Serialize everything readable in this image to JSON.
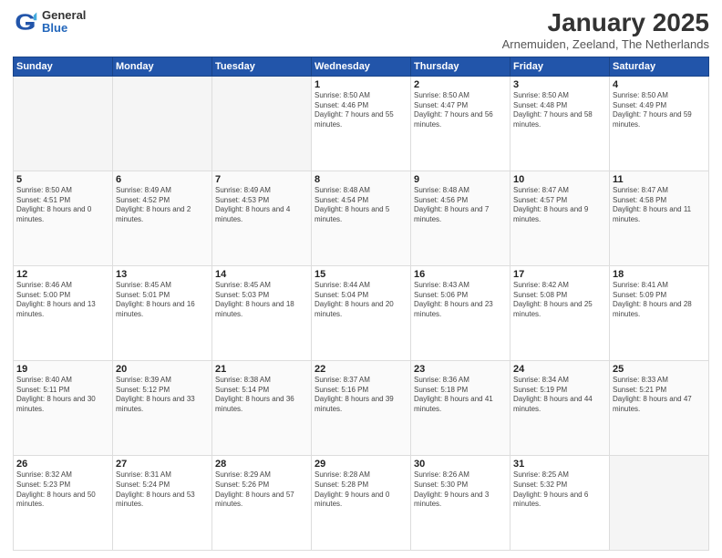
{
  "logo": {
    "general": "General",
    "blue": "Blue"
  },
  "title": "January 2025",
  "subtitle": "Arnemuiden, Zeeland, The Netherlands",
  "days_header": [
    "Sunday",
    "Monday",
    "Tuesday",
    "Wednesday",
    "Thursday",
    "Friday",
    "Saturday"
  ],
  "weeks": [
    [
      {
        "day": "",
        "empty": true
      },
      {
        "day": "",
        "empty": true
      },
      {
        "day": "",
        "empty": true
      },
      {
        "day": "1",
        "sunrise": "8:50 AM",
        "sunset": "4:46 PM",
        "daylight": "7 hours and 55 minutes."
      },
      {
        "day": "2",
        "sunrise": "8:50 AM",
        "sunset": "4:47 PM",
        "daylight": "7 hours and 56 minutes."
      },
      {
        "day": "3",
        "sunrise": "8:50 AM",
        "sunset": "4:48 PM",
        "daylight": "7 hours and 58 minutes."
      },
      {
        "day": "4",
        "sunrise": "8:50 AM",
        "sunset": "4:49 PM",
        "daylight": "7 hours and 59 minutes."
      }
    ],
    [
      {
        "day": "5",
        "sunrise": "8:50 AM",
        "sunset": "4:51 PM",
        "daylight": "8 hours and 0 minutes."
      },
      {
        "day": "6",
        "sunrise": "8:49 AM",
        "sunset": "4:52 PM",
        "daylight": "8 hours and 2 minutes."
      },
      {
        "day": "7",
        "sunrise": "8:49 AM",
        "sunset": "4:53 PM",
        "daylight": "8 hours and 4 minutes."
      },
      {
        "day": "8",
        "sunrise": "8:48 AM",
        "sunset": "4:54 PM",
        "daylight": "8 hours and 5 minutes."
      },
      {
        "day": "9",
        "sunrise": "8:48 AM",
        "sunset": "4:56 PM",
        "daylight": "8 hours and 7 minutes."
      },
      {
        "day": "10",
        "sunrise": "8:47 AM",
        "sunset": "4:57 PM",
        "daylight": "8 hours and 9 minutes."
      },
      {
        "day": "11",
        "sunrise": "8:47 AM",
        "sunset": "4:58 PM",
        "daylight": "8 hours and 11 minutes."
      }
    ],
    [
      {
        "day": "12",
        "sunrise": "8:46 AM",
        "sunset": "5:00 PM",
        "daylight": "8 hours and 13 minutes."
      },
      {
        "day": "13",
        "sunrise": "8:45 AM",
        "sunset": "5:01 PM",
        "daylight": "8 hours and 16 minutes."
      },
      {
        "day": "14",
        "sunrise": "8:45 AM",
        "sunset": "5:03 PM",
        "daylight": "8 hours and 18 minutes."
      },
      {
        "day": "15",
        "sunrise": "8:44 AM",
        "sunset": "5:04 PM",
        "daylight": "8 hours and 20 minutes."
      },
      {
        "day": "16",
        "sunrise": "8:43 AM",
        "sunset": "5:06 PM",
        "daylight": "8 hours and 23 minutes."
      },
      {
        "day": "17",
        "sunrise": "8:42 AM",
        "sunset": "5:08 PM",
        "daylight": "8 hours and 25 minutes."
      },
      {
        "day": "18",
        "sunrise": "8:41 AM",
        "sunset": "5:09 PM",
        "daylight": "8 hours and 28 minutes."
      }
    ],
    [
      {
        "day": "19",
        "sunrise": "8:40 AM",
        "sunset": "5:11 PM",
        "daylight": "8 hours and 30 minutes."
      },
      {
        "day": "20",
        "sunrise": "8:39 AM",
        "sunset": "5:12 PM",
        "daylight": "8 hours and 33 minutes."
      },
      {
        "day": "21",
        "sunrise": "8:38 AM",
        "sunset": "5:14 PM",
        "daylight": "8 hours and 36 minutes."
      },
      {
        "day": "22",
        "sunrise": "8:37 AM",
        "sunset": "5:16 PM",
        "daylight": "8 hours and 39 minutes."
      },
      {
        "day": "23",
        "sunrise": "8:36 AM",
        "sunset": "5:18 PM",
        "daylight": "8 hours and 41 minutes."
      },
      {
        "day": "24",
        "sunrise": "8:34 AM",
        "sunset": "5:19 PM",
        "daylight": "8 hours and 44 minutes."
      },
      {
        "day": "25",
        "sunrise": "8:33 AM",
        "sunset": "5:21 PM",
        "daylight": "8 hours and 47 minutes."
      }
    ],
    [
      {
        "day": "26",
        "sunrise": "8:32 AM",
        "sunset": "5:23 PM",
        "daylight": "8 hours and 50 minutes."
      },
      {
        "day": "27",
        "sunrise": "8:31 AM",
        "sunset": "5:24 PM",
        "daylight": "8 hours and 53 minutes."
      },
      {
        "day": "28",
        "sunrise": "8:29 AM",
        "sunset": "5:26 PM",
        "daylight": "8 hours and 57 minutes."
      },
      {
        "day": "29",
        "sunrise": "8:28 AM",
        "sunset": "5:28 PM",
        "daylight": "9 hours and 0 minutes."
      },
      {
        "day": "30",
        "sunrise": "8:26 AM",
        "sunset": "5:30 PM",
        "daylight": "9 hours and 3 minutes."
      },
      {
        "day": "31",
        "sunrise": "8:25 AM",
        "sunset": "5:32 PM",
        "daylight": "9 hours and 6 minutes."
      },
      {
        "day": "",
        "empty": true
      }
    ]
  ]
}
